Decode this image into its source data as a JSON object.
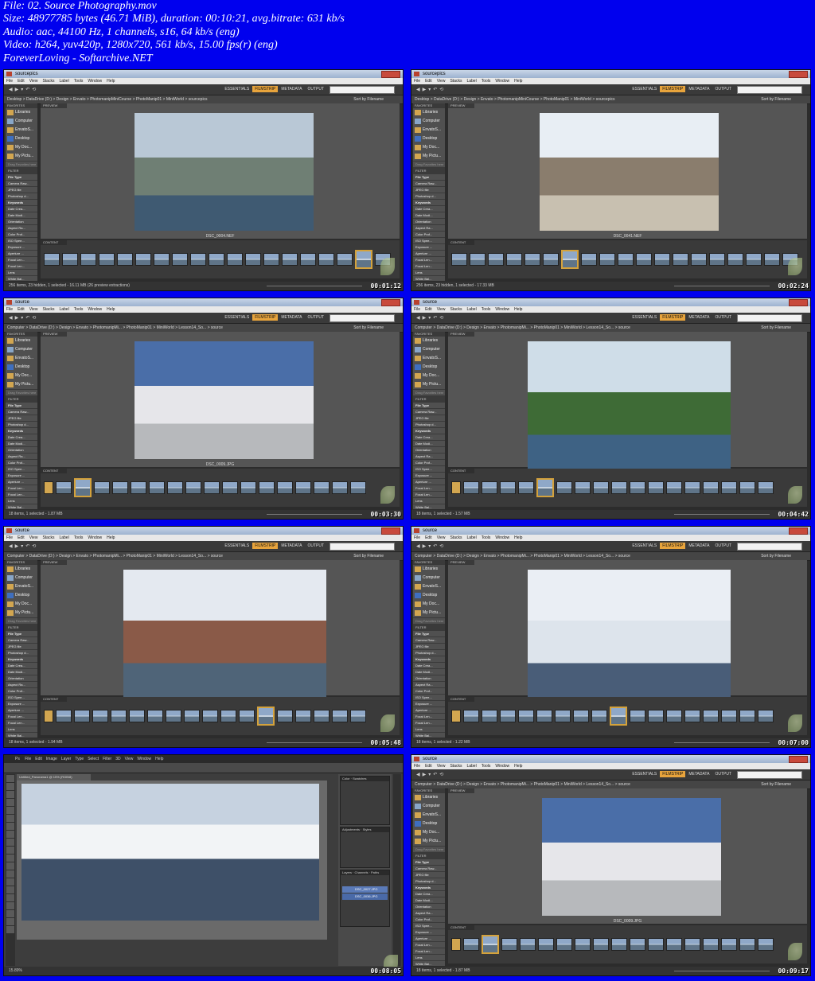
{
  "header": {
    "lines": [
      "File: 02. Source Photography.mov",
      "Size: 48977785 bytes (46.71 MiB), duration: 00:10:21, avg.bitrate: 631 kb/s",
      "Audio: aac, 44100 Hz, 1 channels, s16, 64 kb/s (eng)",
      "Video: h264, yuv420p, 1280x720, 561 kb/s, 15.00 fps(r) (eng)",
      "ForeverLoving - Softarchive.NET"
    ]
  },
  "bridge": {
    "menu": [
      "File",
      "Edit",
      "View",
      "Stacks",
      "Label",
      "Tools",
      "Window",
      "Help"
    ],
    "workspaces": [
      "ESSENTIALS",
      "FILMSTRIP",
      "METADATA",
      "OUTPUT"
    ],
    "active_workspace": "FILMSTRIP",
    "sort_label": "Sort by Filename",
    "panel_favorites": "FAVORITES",
    "panel_preview": "PREVIEW",
    "panel_content": "CONTENT",
    "panel_filter": "FILTER",
    "favorites": [
      "Libraries",
      "Computer",
      "EnvatoS...",
      "Desktop",
      "My Doc...",
      "My Pictu..."
    ],
    "drag_favorites": "Drag Favorites here",
    "filters": [
      "File Type",
      "Camera Raw...",
      "JPEG file",
      "Photoshop d...",
      "Keywords",
      "Date Crea...",
      "Date Modi...",
      "Orientation",
      "Aspect Ra...",
      "Color Prof...",
      "ISO Spee...",
      "Exposure ...",
      "Aperture ...",
      "Focal Len...",
      "Focal Len...",
      "Lens",
      "White Bal..."
    ]
  },
  "frames": [
    {
      "window_title": "sourcepics",
      "path": "Desktop > DataDrive (D:) > Design > Envato > PhotomanipMiniCourse > PhotoManip01 > MiniWorld > sourcepics",
      "caption": "DSC_0004.NEF",
      "status": "256 items, 23 hidden, 1 selected - 16.11 MB (26 preview extractions)",
      "timecode": "00:01:12"
    },
    {
      "window_title": "sourcepics",
      "path": "Desktop > DataDrive (D:) > Design > Envato > PhotomanipMiniCourse > PhotoManip01 > MiniWorld > sourcepics",
      "caption": "DSC_0041.NEF",
      "status": "256 items, 23 hidden, 1 selected - 17.33 MB",
      "timecode": "00:02:24"
    },
    {
      "window_title": "source",
      "path": "Computer > DataDrive (D:) > Design > Envato > PhotomanipMi... > PhotoManip01 > MiniWorld > Lesson14_So... > source",
      "caption": "DSC_0009.JPG",
      "status": "18 items, 1 selected - 1.87 MB",
      "timecode": "00:03:30"
    },
    {
      "window_title": "source",
      "path": "Computer > DataDrive (D:) > Design > Envato > PhotomanipMi... > PhotoManip01 > MiniWorld > Lesson14_So... > source",
      "caption": "DSC_0015.JPG",
      "status": "18 items, 1 selected - 1.57 MB",
      "timecode": "00:04:42"
    },
    {
      "window_title": "source",
      "path": "Computer > DataDrive (D:) > Design > Envato > PhotomanipMi... > PhotoManip01 > MiniWorld > Lesson14_So... > source",
      "caption": "DSC_0022.JPG",
      "status": "18 items, 1 selected - 1.94 MB",
      "timecode": "00:05:48"
    },
    {
      "window_title": "source",
      "path": "Computer > DataDrive (D:) > Design > Envato > PhotomanipMi... > PhotoManip01 > MiniWorld > Lesson14_So... > source",
      "caption": "DSC_0027.JPG",
      "status": "18 items, 1 selected - 1.22 MB",
      "timecode": "00:07:00"
    },
    {
      "window_title": "Ps",
      "ps_menu": [
        "File",
        "Edit",
        "Image",
        "Layer",
        "Type",
        "Select",
        "Filter",
        "3D",
        "View",
        "Window",
        "Help"
      ],
      "doc_tab": "Untitled_Panorama1 @ 15% (RGB/8)",
      "layers": [
        "DSC_0027.JPG",
        "DSC_0036.JPG"
      ],
      "status": "15.89%",
      "timecode": "00:08:05"
    },
    {
      "window_title": "source",
      "path": "Computer > DataDrive (D:) > Design > Envato > PhotomanipMi... > PhotoManip01 > MiniWorld > Lesson14_So... > source",
      "caption": "DSC_0009.JPG",
      "status": "18 items, 1 selected - 1.87 MB",
      "timecode": "00:09:17"
    }
  ]
}
